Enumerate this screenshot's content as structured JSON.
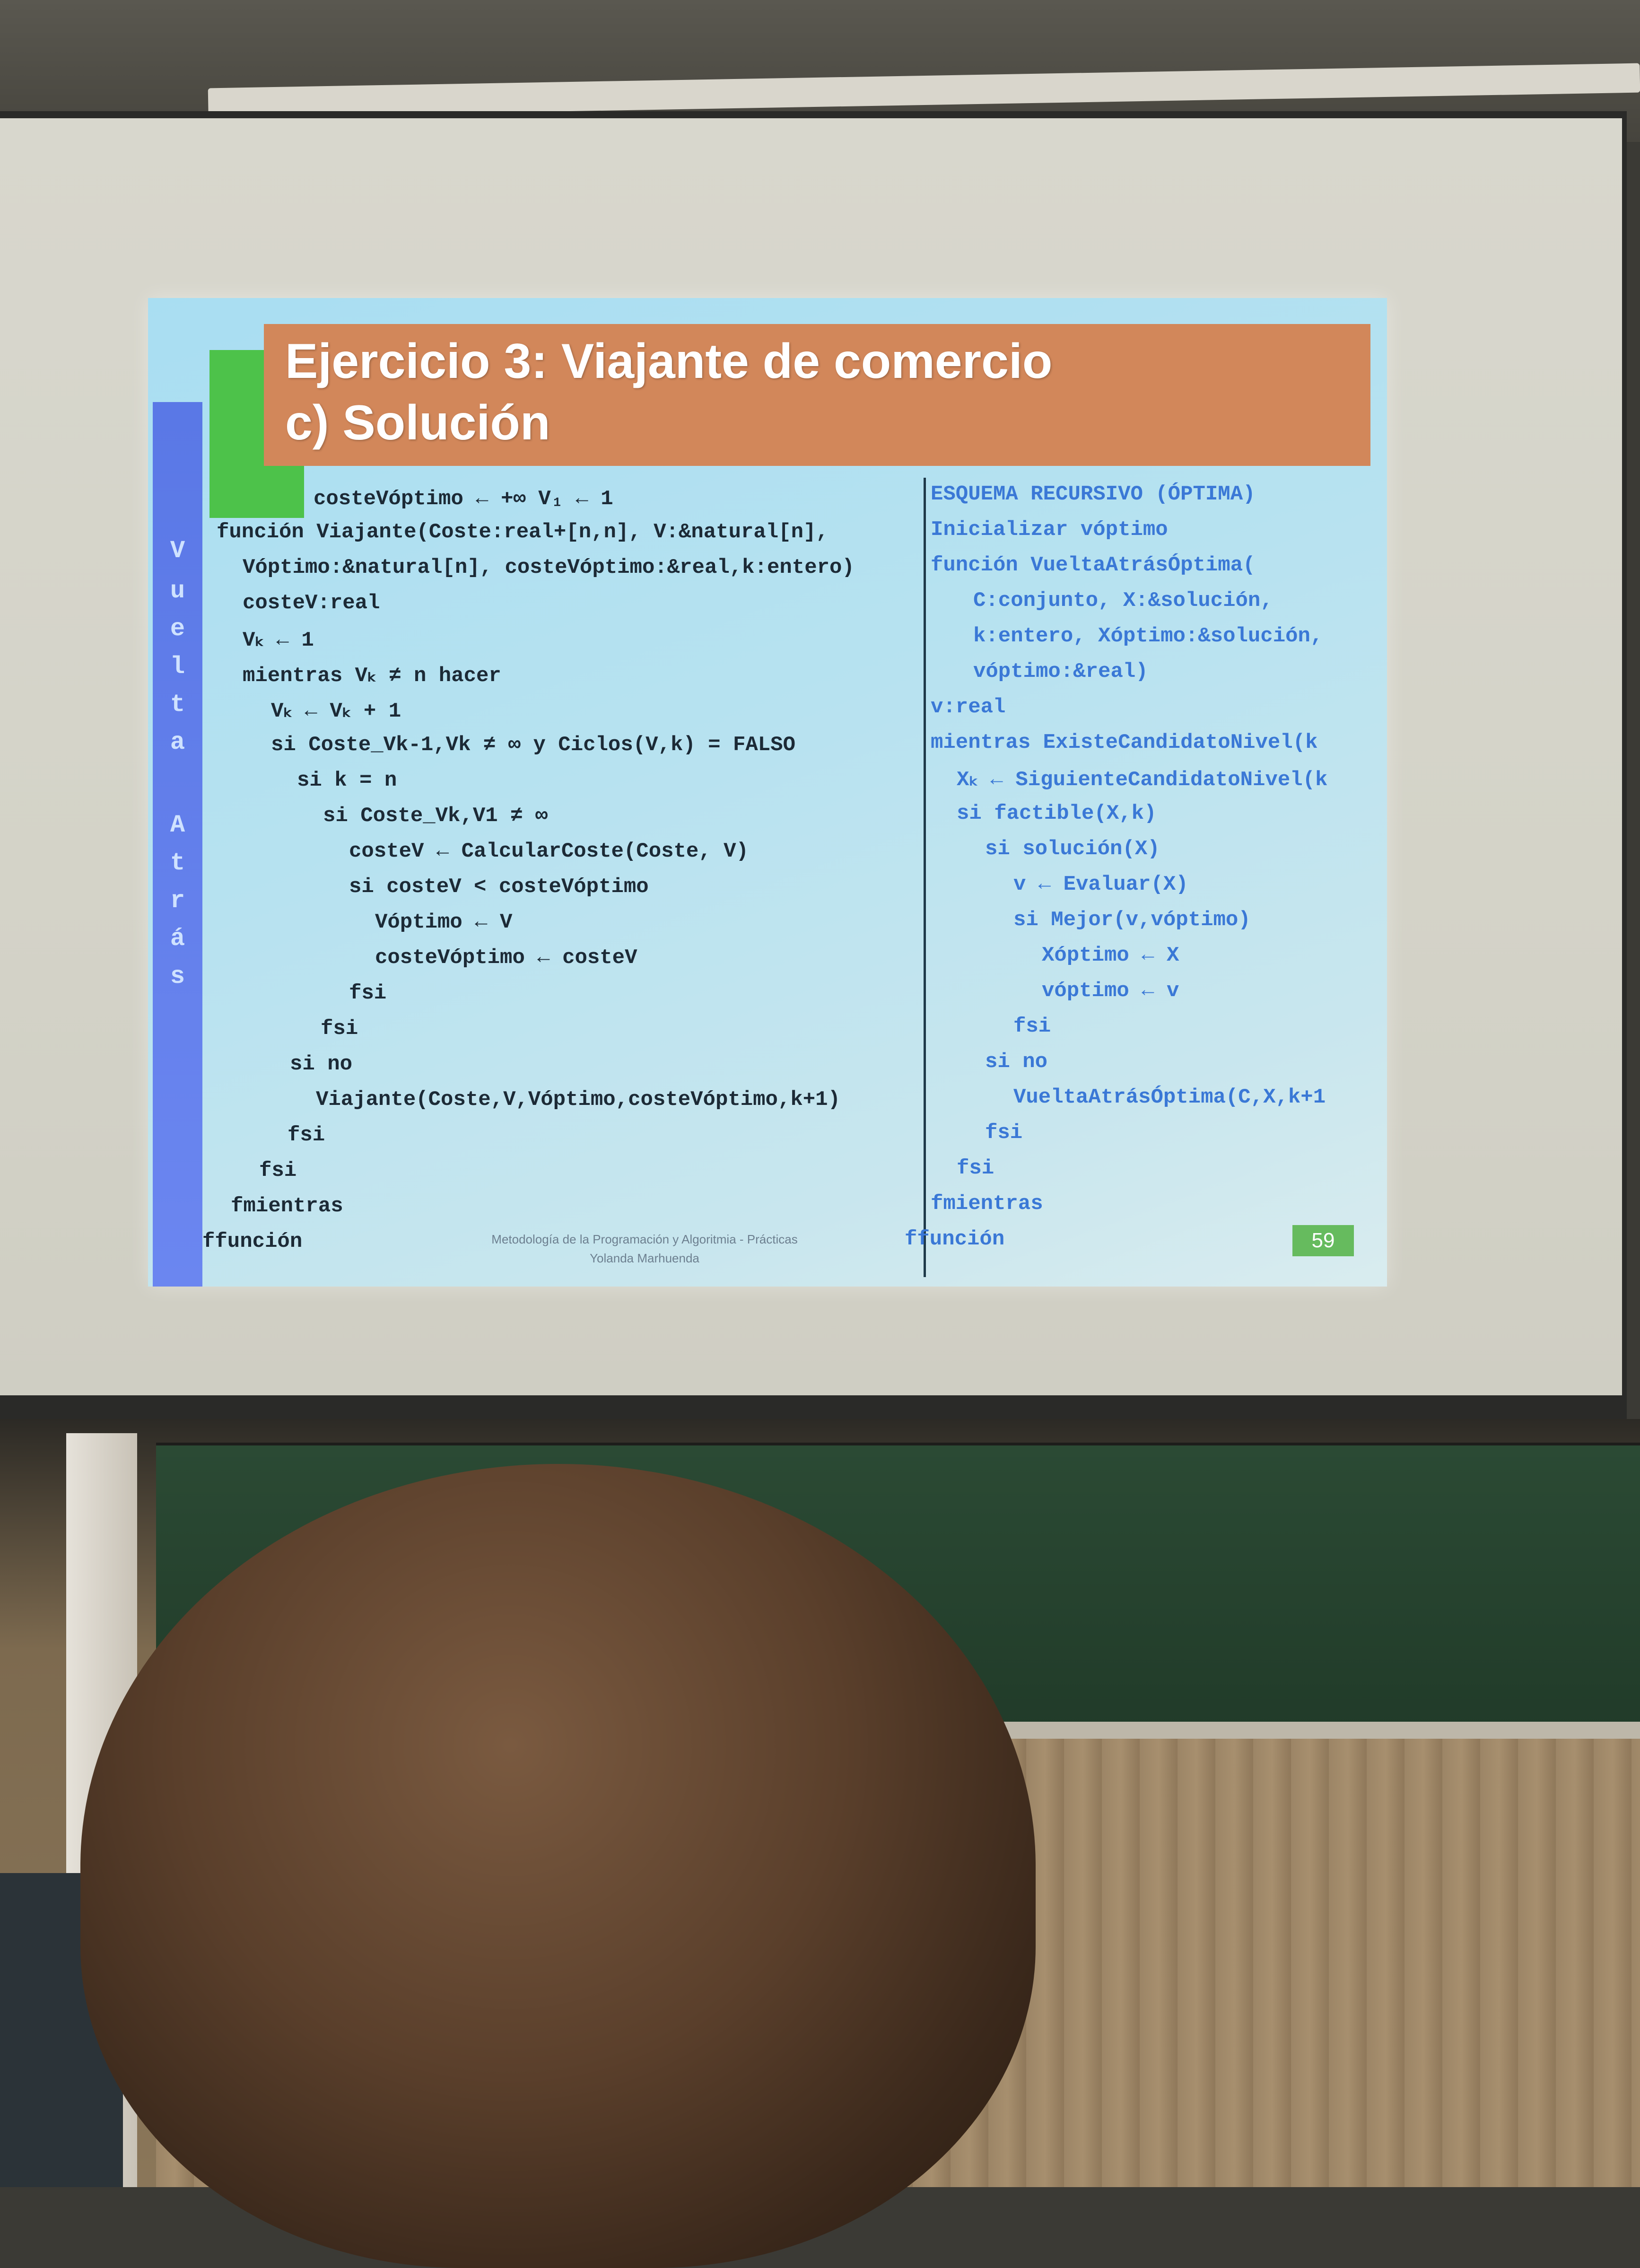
{
  "slide": {
    "title_line1": "Ejercicio 3: Viajante de comercio",
    "title_line2": "c) Solución",
    "side_letters": [
      "V",
      "u",
      "e",
      "l",
      "t",
      "a",
      "A",
      "t",
      "r",
      "á",
      "s"
    ],
    "left_code": [
      "costeVóptimo ← +∞        V₁ ← 1",
      "función Viajante(Coste:real+[n,n], V:&natural[n],",
      "Vóptimo:&natural[n], costeVóptimo:&real,k:entero)",
      "costeV:real",
      "Vₖ ← 1",
      "mientras Vₖ ≠ n hacer",
      "Vₖ ← Vₖ + 1",
      "si Coste_Vk-1,Vk ≠ ∞  y  Ciclos(V,k) = FALSO",
      "si k = n",
      "si Coste_Vk,V1 ≠ ∞",
      "costeV ← CalcularCoste(Coste, V)",
      "si costeV < costeVóptimo",
      "Vóptimo ← V",
      "costeVóptimo ← costeV",
      "fsi",
      "fsi",
      "si no",
      "Viajante(Coste,V,Vóptimo,costeVóptimo,k+1)",
      "fsi",
      "fsi",
      "fmientras",
      "ffunción"
    ],
    "right_code": [
      "ESQUEMA RECURSIVO (ÓPTIMA)",
      "Inicializar vóptimo",
      "función VueltaAtrásÓptima(",
      "C:conjunto, X:&solución,",
      "k:entero, Xóptimo:&solución,",
      "vóptimo:&real)",
      "v:real",
      "mientras ExisteCandidatoNivel(k",
      "Xₖ ← SiguienteCandidatoNivel(k",
      "si factible(X,k)",
      "si solución(X)",
      "v ← Evaluar(X)",
      "si Mejor(v,vóptimo)",
      "Xóptimo ← X",
      "vóptimo ← v",
      "fsi",
      "si no",
      "VueltaAtrásÓptima(C,X,k+1",
      "fsi",
      "fsi",
      "fmientras",
      "ffunción"
    ],
    "footer_line1": "Metodología de la Programación y Algoritmia - Prácticas",
    "footer_line2": "Yolanda Marhuenda",
    "page_number": "59"
  },
  "colors": {
    "title_bg": "#d2875a",
    "accent_green": "#4dc24a",
    "side_bar": "#5a78e6",
    "code_dark": "#1c2a36",
    "code_blue": "#3a78d6",
    "code_orange": "#d98a55"
  }
}
